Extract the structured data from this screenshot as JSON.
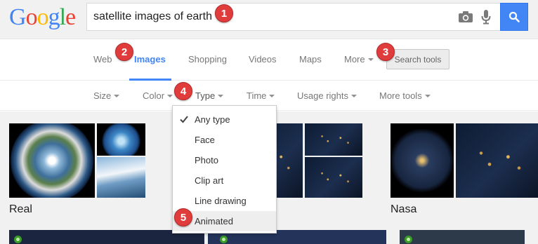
{
  "logo": {
    "letters": [
      {
        "ch": "G",
        "color": "#4285f4"
      },
      {
        "ch": "o",
        "color": "#ea4335"
      },
      {
        "ch": "o",
        "color": "#fbbc05"
      },
      {
        "ch": "g",
        "color": "#4285f4"
      },
      {
        "ch": "l",
        "color": "#34a853"
      },
      {
        "ch": "e",
        "color": "#ea4335"
      }
    ]
  },
  "search": {
    "value": "satellite images of earth",
    "camera_icon": "camera-icon",
    "mic_icon": "microphone-icon",
    "button_icon": "magnifier-icon"
  },
  "nav": {
    "tabs": [
      "Web",
      "Images",
      "Shopping",
      "Videos",
      "Maps",
      "More"
    ],
    "active_tab": "Images",
    "search_tools_label": "Search tools"
  },
  "tools": {
    "items": [
      "Size",
      "Color",
      "Type",
      "Time",
      "Usage rights",
      "More tools"
    ]
  },
  "type_menu": {
    "items": [
      "Any type",
      "Face",
      "Photo",
      "Clip art",
      "Line drawing",
      "Animated"
    ],
    "selected": "Any type",
    "hovered": "Animated"
  },
  "results": {
    "captions": [
      "Real",
      "Nasa"
    ]
  },
  "badges": [
    "1",
    "2",
    "3",
    "4",
    "5"
  ],
  "colors": {
    "accent": "#4285f4",
    "badge": "#e03c3c",
    "header_bg": "#f1f1f1"
  }
}
